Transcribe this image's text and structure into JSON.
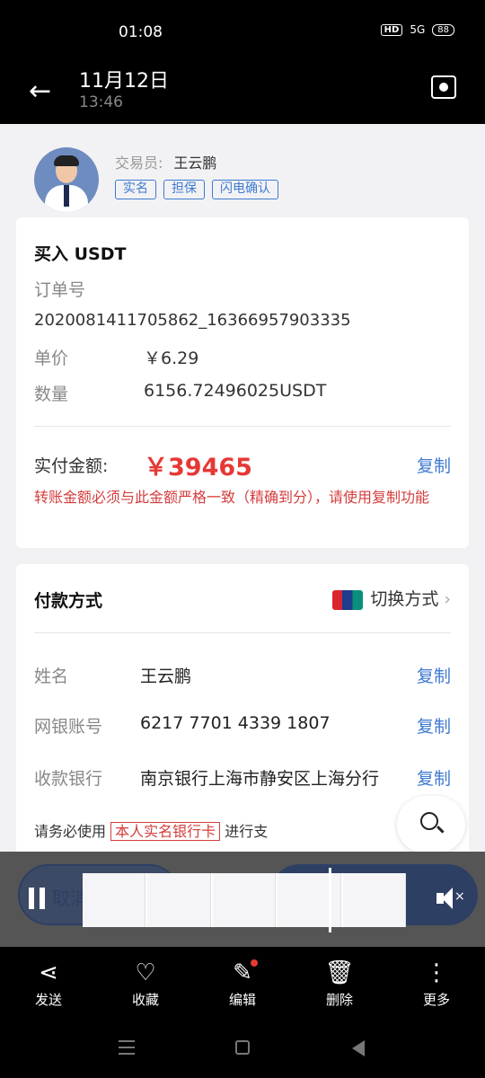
{
  "status_bar": {
    "time": "01:08",
    "hd": "HD",
    "signal": "5G",
    "battery": "88"
  },
  "header": {
    "title": "11月12日",
    "subtitle": "13:46",
    "back_icon": "arrow-left-icon",
    "screenshot_icon": "camera-icon"
  },
  "trader": {
    "label": "交易员:",
    "name": "王云鹏",
    "badges": [
      "实名",
      "担保",
      "闪电确认"
    ]
  },
  "order": {
    "title": "买入 USDT",
    "order_no_label": "订单号",
    "order_no": "2020081411705862_16366957903335",
    "price_label": "单价",
    "price": "￥6.29",
    "qty_label": "数量",
    "qty": "6156.72496025USDT",
    "paid_label": "实付金额:",
    "paid_amount": "￥39465",
    "copy_label": "复制",
    "warning": "转账金额必须与此金额严格一致（精确到分），请使用复制功能"
  },
  "payment": {
    "title": "付款方式",
    "switch_label": "切换方式",
    "name_label": "姓名",
    "name": "王云鹏",
    "account_label": "网银账号",
    "account": "6217 7701 4339 1807",
    "bank_label": "收款银行",
    "bank": "南京银行上海市静安区上海分行",
    "copy_label": "复制",
    "note_prefix": "请务必使用",
    "note_highlight": "本人实名银行卡",
    "note_suffix": "进行支"
  },
  "player": {
    "cancel_label": "取消",
    "pause_icon": "pause-icon",
    "mute_icon": "mute-icon"
  },
  "actions": [
    {
      "label": "发送",
      "icon": "share-icon"
    },
    {
      "label": "收藏",
      "icon": "heart-icon"
    },
    {
      "label": "编辑",
      "icon": "edit-icon"
    },
    {
      "label": "删除",
      "icon": "trash-icon"
    },
    {
      "label": "更多",
      "icon": "more-icon"
    }
  ],
  "colors": {
    "accent": "#3f7ad1",
    "amount": "#e53935",
    "warning": "#d43d3d"
  }
}
